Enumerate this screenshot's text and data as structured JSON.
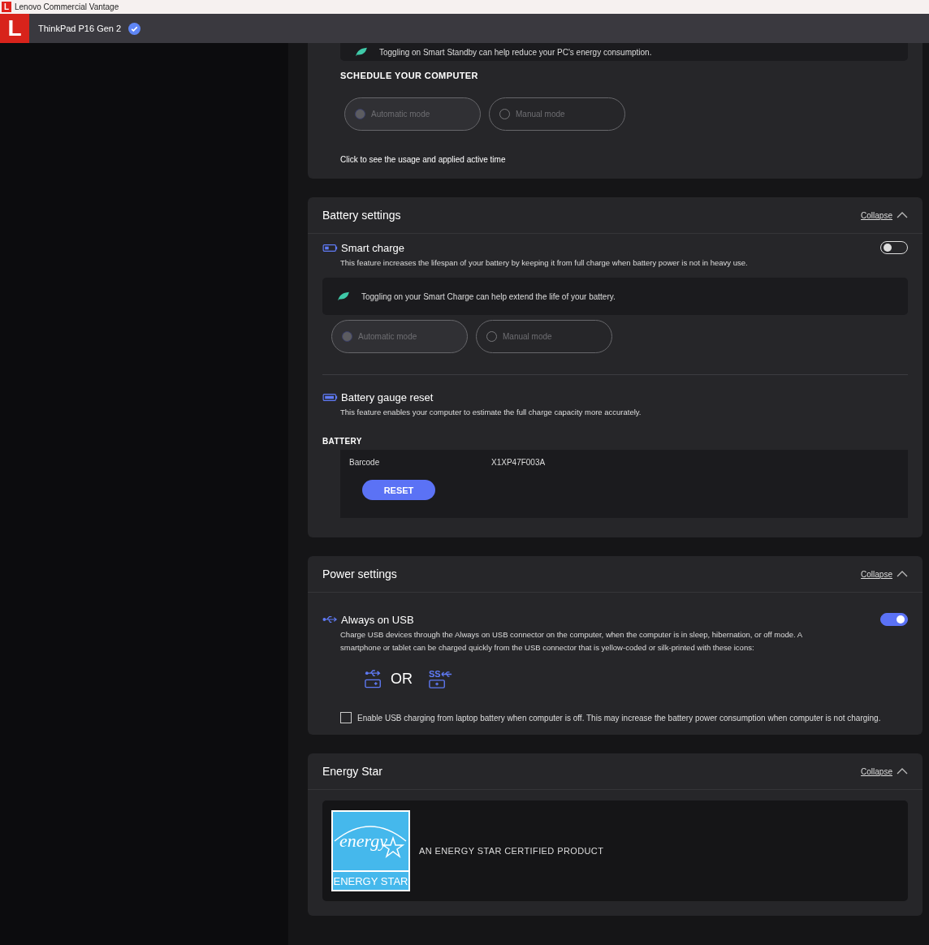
{
  "title_bar": {
    "logo": "L",
    "title": "Lenovo Commercial Vantage"
  },
  "header": {
    "logo": "L",
    "device": "ThinkPad P16 Gen 2",
    "verified": true
  },
  "smart_standby": {
    "note": "Toggling on Smart Standby can help reduce your PC's energy consumption.",
    "schedule_heading": "SCHEDULE YOUR COMPUTER",
    "modes": [
      {
        "label": "Automatic mode",
        "selected": true,
        "disabled": true
      },
      {
        "label": "Manual mode",
        "selected": false,
        "disabled": true
      }
    ],
    "link": "Click to see the usage and applied active time"
  },
  "battery_settings": {
    "title": "Battery settings",
    "collapse": "Collapse",
    "smart_charge": {
      "title": "Smart charge",
      "on": false,
      "description": "This feature increases the lifespan of your battery by keeping it from full charge when battery power is not in heavy use.",
      "note": "Toggling on your Smart Charge can help extend the life of your battery.",
      "modes": [
        {
          "label": "Automatic mode",
          "selected": true,
          "disabled": true
        },
        {
          "label": "Manual mode",
          "selected": false,
          "disabled": true
        }
      ]
    },
    "gauge_reset": {
      "title": "Battery gauge reset",
      "description": "This feature enables your computer to estimate the full charge capacity more accurately.",
      "heading": "BATTERY",
      "field": "Barcode",
      "value": "X1XP47F003A",
      "button": "RESET"
    }
  },
  "power_settings": {
    "title": "Power settings",
    "collapse": "Collapse",
    "always_on_usb": {
      "title": "Always on USB",
      "on": true,
      "description": "Charge USB devices through the Always on USB connector on the computer, when the computer is in sleep, hibernation, or off mode. A smartphone or tablet can be charged quickly from the USB connector that is yellow-coded or silk-printed with these icons:",
      "or": "OR",
      "ss_label": "SS",
      "checkbox": {
        "label": "Enable USB charging from laptop battery when computer is off. This may increase the battery power consumption when computer is not charging.",
        "checked": false
      }
    }
  },
  "energy_star": {
    "title": "Energy Star",
    "collapse": "Collapse",
    "logo_script": "energy",
    "logo_label": "ENERGY STAR",
    "text": "AN ENERGY STAR CERTIFIED PRODUCT"
  }
}
